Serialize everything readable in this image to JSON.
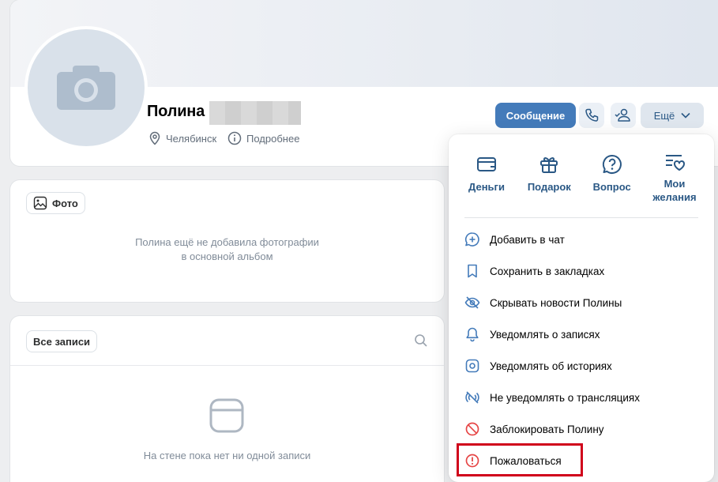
{
  "profile": {
    "name": "Полина",
    "city": "Челябинск",
    "details_link": "Подробнее"
  },
  "actions": {
    "message_label": "Сообщение",
    "more_label": "Ещё"
  },
  "photos": {
    "chip_label": "Фото",
    "empty_text_line1": "Полина ещё не добавила фотографии",
    "empty_text_line2": "в основной альбом"
  },
  "wall": {
    "chip_label": "Все записи",
    "empty_text": "На стене пока нет ни одной записи"
  },
  "dropdown": {
    "quick_actions": [
      {
        "label": "Деньги",
        "icon": "card-icon"
      },
      {
        "label": "Подарок",
        "icon": "gift-icon"
      },
      {
        "label": "Вопрос",
        "icon": "question-icon"
      },
      {
        "label": "Мои желания",
        "icon": "wishlist-icon"
      }
    ],
    "items": [
      {
        "label": "Добавить в чат",
        "icon": "add-chat-icon"
      },
      {
        "label": "Сохранить в закладках",
        "icon": "bookmark-icon"
      },
      {
        "label": "Скрывать новости Полины",
        "icon": "hidden-eye-icon"
      },
      {
        "label": "Уведомлять о записях",
        "icon": "bell-icon"
      },
      {
        "label": "Уведомлять об историях",
        "icon": "story-icon"
      },
      {
        "label": "Не уведомлять о трансляциях",
        "icon": "no-broadcast-icon"
      },
      {
        "label": "Заблокировать Полину",
        "icon": "block-icon"
      },
      {
        "label": "Пожаловаться",
        "icon": "report-icon"
      }
    ]
  },
  "colors": {
    "accent": "#447bba",
    "link": "#2a5885",
    "danger": "#e64646",
    "highlight": "#d0021b"
  }
}
